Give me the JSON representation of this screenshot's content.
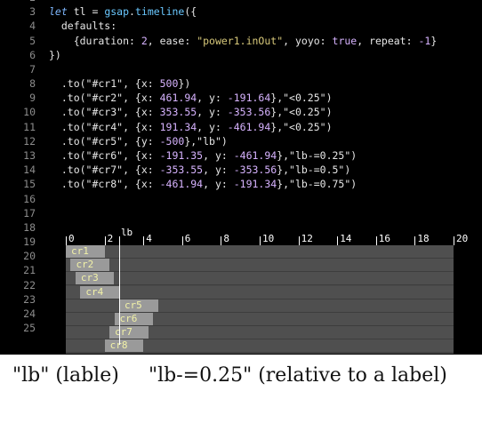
{
  "editor": {
    "lines": [
      {
        "n": "2",
        "parts": []
      },
      {
        "n": "3",
        "parts": [
          [
            "kw",
            "let"
          ],
          [
            "plain",
            " tl = "
          ],
          [
            "fn",
            "gsap"
          ],
          [
            "plain",
            "."
          ],
          [
            "fn",
            "timeline"
          ],
          [
            "plain",
            "({"
          ]
        ]
      },
      {
        "n": "4",
        "parts": [
          [
            "plain",
            "  defaults:"
          ]
        ]
      },
      {
        "n": "5",
        "parts": [
          [
            "plain",
            "    {duration: "
          ],
          [
            "num",
            "2"
          ],
          [
            "plain",
            ", ease: "
          ],
          [
            "str",
            "\"power1.inOut\""
          ],
          [
            "plain",
            ", yoyo: "
          ],
          [
            "bool",
            "true"
          ],
          [
            "plain",
            ", repeat: "
          ],
          [
            "num",
            "-1"
          ],
          [
            "plain",
            "}"
          ]
        ]
      },
      {
        "n": "6",
        "parts": [
          [
            "plain",
            "})"
          ]
        ]
      },
      {
        "n": "7",
        "parts": []
      },
      {
        "n": "8",
        "parts": [
          [
            "plain",
            "  .to(\"#cr1\", {x: "
          ],
          [
            "num",
            "500"
          ],
          [
            "plain",
            "})"
          ]
        ]
      },
      {
        "n": "9",
        "parts": [
          [
            "plain",
            "  .to(\"#cr2\", {x: "
          ],
          [
            "num",
            "461.94"
          ],
          [
            "plain",
            ", y: "
          ],
          [
            "num",
            "-191.64"
          ],
          [
            "plain",
            "},\"<0.25\")"
          ]
        ]
      },
      {
        "n": "10",
        "parts": [
          [
            "plain",
            "  .to(\"#cr3\", {x: "
          ],
          [
            "num",
            "353.55"
          ],
          [
            "plain",
            ", y: "
          ],
          [
            "num",
            "-353.56"
          ],
          [
            "plain",
            "},\"<0.25\")"
          ]
        ]
      },
      {
        "n": "11",
        "parts": [
          [
            "plain",
            "  .to(\"#cr4\", {x: "
          ],
          [
            "num",
            "191.34"
          ],
          [
            "plain",
            ", y: "
          ],
          [
            "num",
            "-461.94"
          ],
          [
            "plain",
            "},\"<0.25\")"
          ]
        ]
      },
      {
        "n": "12",
        "parts": [
          [
            "plain",
            "  .to(\"#cr5\", {y: "
          ],
          [
            "num",
            "-500"
          ],
          [
            "plain",
            "},\"lb\")"
          ]
        ]
      },
      {
        "n": "13",
        "parts": [
          [
            "plain",
            "  .to(\"#cr6\", {x: "
          ],
          [
            "num",
            "-191.35"
          ],
          [
            "plain",
            ", y: "
          ],
          [
            "num",
            "-461.94"
          ],
          [
            "plain",
            "},\"lb-=0.25\")"
          ]
        ]
      },
      {
        "n": "14",
        "parts": [
          [
            "plain",
            "  .to(\"#cr7\", {x: "
          ],
          [
            "num",
            "-353.55"
          ],
          [
            "plain",
            ", y: "
          ],
          [
            "num",
            "-353.56"
          ],
          [
            "plain",
            "},\"lb-=0.5\")"
          ]
        ]
      },
      {
        "n": "15",
        "parts": [
          [
            "plain",
            "  .to(\"#cr8\", {x: "
          ],
          [
            "num",
            "-461.94"
          ],
          [
            "plain",
            ", y: "
          ],
          [
            "num",
            "-191.34"
          ],
          [
            "plain",
            "},\"lb-=0.75\")"
          ]
        ]
      },
      {
        "n": "16",
        "parts": []
      },
      {
        "n": "17",
        "parts": []
      },
      {
        "n": "18",
        "parts": []
      },
      {
        "n": "19",
        "parts": []
      },
      {
        "n": "20",
        "parts": []
      },
      {
        "n": "21",
        "parts": []
      },
      {
        "n": "22",
        "parts": []
      },
      {
        "n": "23",
        "parts": []
      },
      {
        "n": "24",
        "parts": []
      },
      {
        "n": "25",
        "parts": []
      }
    ],
    "syntax_colors": {
      "keyword": "#7fb8ff",
      "function": "#6ac8ff",
      "string": "#d7c87a",
      "number": "#d7b3ff",
      "plain": "#e6e6e6",
      "line_number": "#8c8c8c",
      "background": "#000000"
    }
  },
  "timeline": {
    "ticks": [
      "0",
      "2",
      "4",
      "6",
      "8",
      "10",
      "12",
      "14",
      "16",
      "18",
      "20"
    ],
    "max_time": 20,
    "label": {
      "name": "lb",
      "time": 2.75
    },
    "tweens": [
      {
        "name": "cr1",
        "start": 0.0,
        "duration": 2
      },
      {
        "name": "cr2",
        "start": 0.25,
        "duration": 2
      },
      {
        "name": "cr3",
        "start": 0.5,
        "duration": 2
      },
      {
        "name": "cr4",
        "start": 0.75,
        "duration": 2
      },
      {
        "name": "cr5",
        "start": 2.75,
        "duration": 2
      },
      {
        "name": "cr6",
        "start": 2.5,
        "duration": 2
      },
      {
        "name": "cr7",
        "start": 2.25,
        "duration": 2
      },
      {
        "name": "cr8",
        "start": 2.0,
        "duration": 2
      }
    ],
    "colors": {
      "track": "#4f4f4f",
      "bar": "#9a9a9a",
      "bar_text": "#f2f2a8",
      "ruler_text": "#ffffff"
    }
  },
  "caption": {
    "part1": "\"lb\" (lable)",
    "part2": "\"lb-=0.25\" (relative to a label)"
  }
}
